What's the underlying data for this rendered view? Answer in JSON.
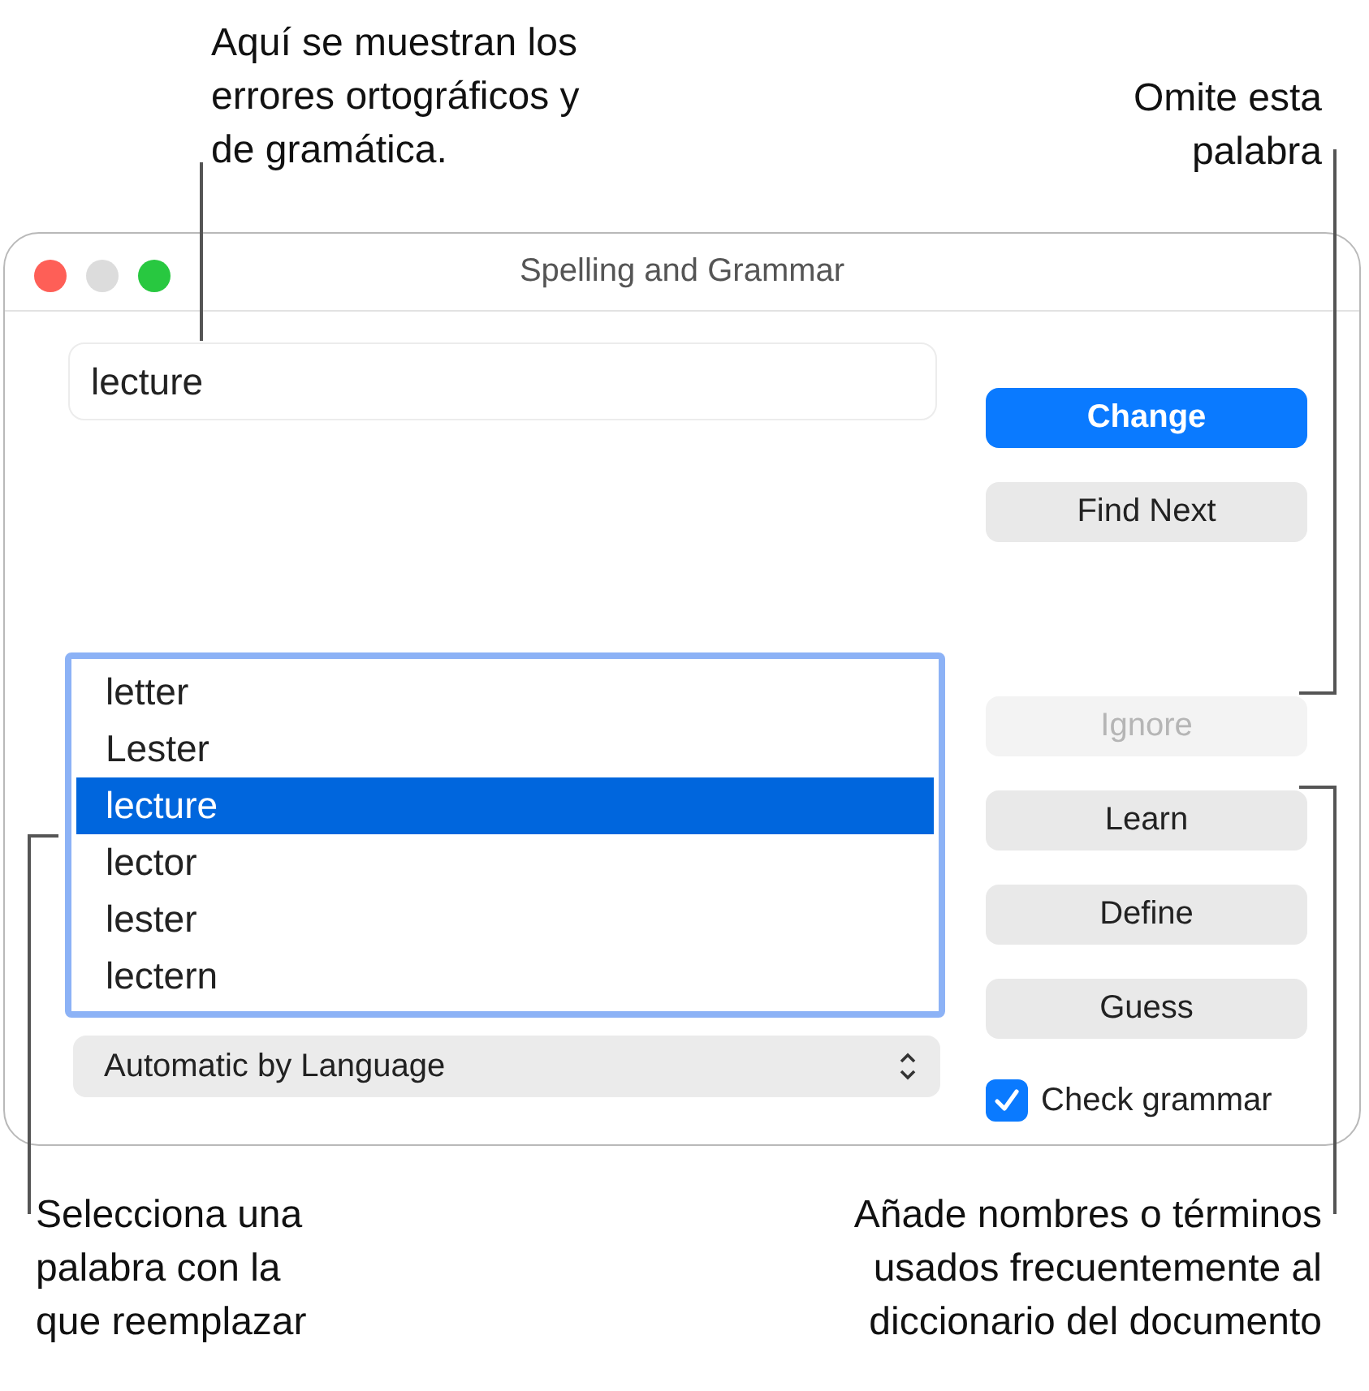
{
  "callouts": {
    "top_left": "Aquí se muestran los\nerrores ortográficos y\nde gramática.",
    "top_right": "Omite esta\npalabra",
    "bottom_left": "Selecciona una\npalabra con la\nque reemplazar",
    "bottom_right": "Añade nombres o términos\nusados frecuentemente al\ndiccionario del documento"
  },
  "window": {
    "title": "Spelling and Grammar"
  },
  "misspelled_field": {
    "value": "lecture"
  },
  "suggestions": [
    {
      "label": "letter",
      "selected": false
    },
    {
      "label": "Lester",
      "selected": false
    },
    {
      "label": "lecture",
      "selected": true
    },
    {
      "label": "lector",
      "selected": false
    },
    {
      "label": "lester",
      "selected": false
    },
    {
      "label": "lectern",
      "selected": false
    }
  ],
  "language_popup": {
    "value": "Automatic by Language"
  },
  "buttons": [
    {
      "label": "Change",
      "kind": "primary",
      "disabled": false
    },
    {
      "label": "Find Next",
      "kind": "normal",
      "disabled": false
    },
    {
      "label": "Ignore",
      "kind": "normal",
      "disabled": true
    },
    {
      "label": "Learn",
      "kind": "normal",
      "disabled": false
    },
    {
      "label": "Define",
      "kind": "normal",
      "disabled": false
    },
    {
      "label": "Guess",
      "kind": "normal",
      "disabled": false
    }
  ],
  "check_grammar": {
    "label": "Check grammar",
    "checked": true
  }
}
